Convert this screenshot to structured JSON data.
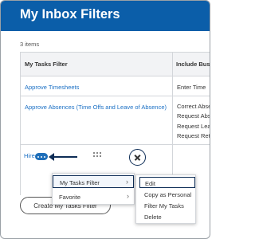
{
  "header": {
    "title": "My Inbox Filters"
  },
  "items_count": "3 items",
  "table": {
    "columns": [
      "My Tasks Filter",
      "Include Busin"
    ],
    "rows": [
      {
        "filter": "Approve Timesheets",
        "include": [
          "Enter Time"
        ]
      },
      {
        "filter": "Approve Absences (Time Offs and Leave of Absence)",
        "include": [
          "Correct Absen",
          "Request Abser",
          "Request Leave",
          "Request Returr"
        ]
      },
      {
        "filter": "Hire",
        "include": []
      }
    ]
  },
  "row_actions_icon": "ellipsis-icon",
  "menu": {
    "items": [
      {
        "label": "My Tasks Filter",
        "chevron": "›"
      },
      {
        "label": "Favorite",
        "chevron": "›"
      }
    ],
    "submenu": [
      "Edit",
      "Copy as Personal",
      "Filter My Tasks",
      "Delete"
    ]
  },
  "create_button": "Create My Tasks Filter",
  "colors": {
    "header_bg": "#0b5ea9",
    "link": "#1a6fc4",
    "highlight_border": "#0e2d56"
  }
}
